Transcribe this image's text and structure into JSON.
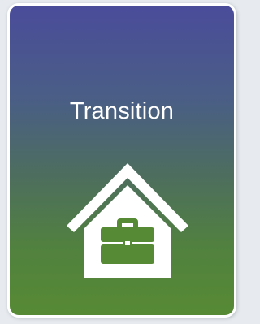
{
  "card": {
    "title": "Transition",
    "icon": "house-with-briefcase-icon"
  },
  "colors": {
    "gradient_top": "#4a4c9a",
    "gradient_bottom": "#578a34",
    "border": "#ffffff",
    "text": "#ffffff"
  }
}
